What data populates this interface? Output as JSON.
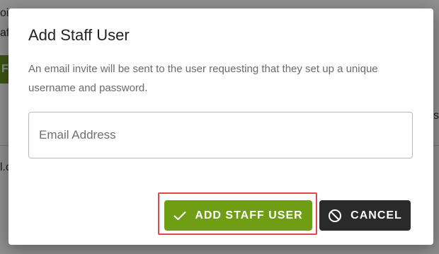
{
  "background": {
    "fragments": [
      "oi",
      "af",
      "F",
      "s",
      "l.c"
    ]
  },
  "modal": {
    "title": "Add Staff User",
    "description": "An email invite will be sent to the user requesting that they set up a unique username and password.",
    "email_placeholder": "Email Address",
    "email_value": "",
    "add_button_label": "ADD STAFF USER",
    "cancel_button_label": "CANCEL"
  },
  "colors": {
    "primary_green": "#6f9e14",
    "cancel_dark": "#2a2a2a",
    "highlight_red": "#e0474c"
  },
  "icons": {
    "add": "checkmark-icon",
    "cancel": "ban-icon"
  }
}
